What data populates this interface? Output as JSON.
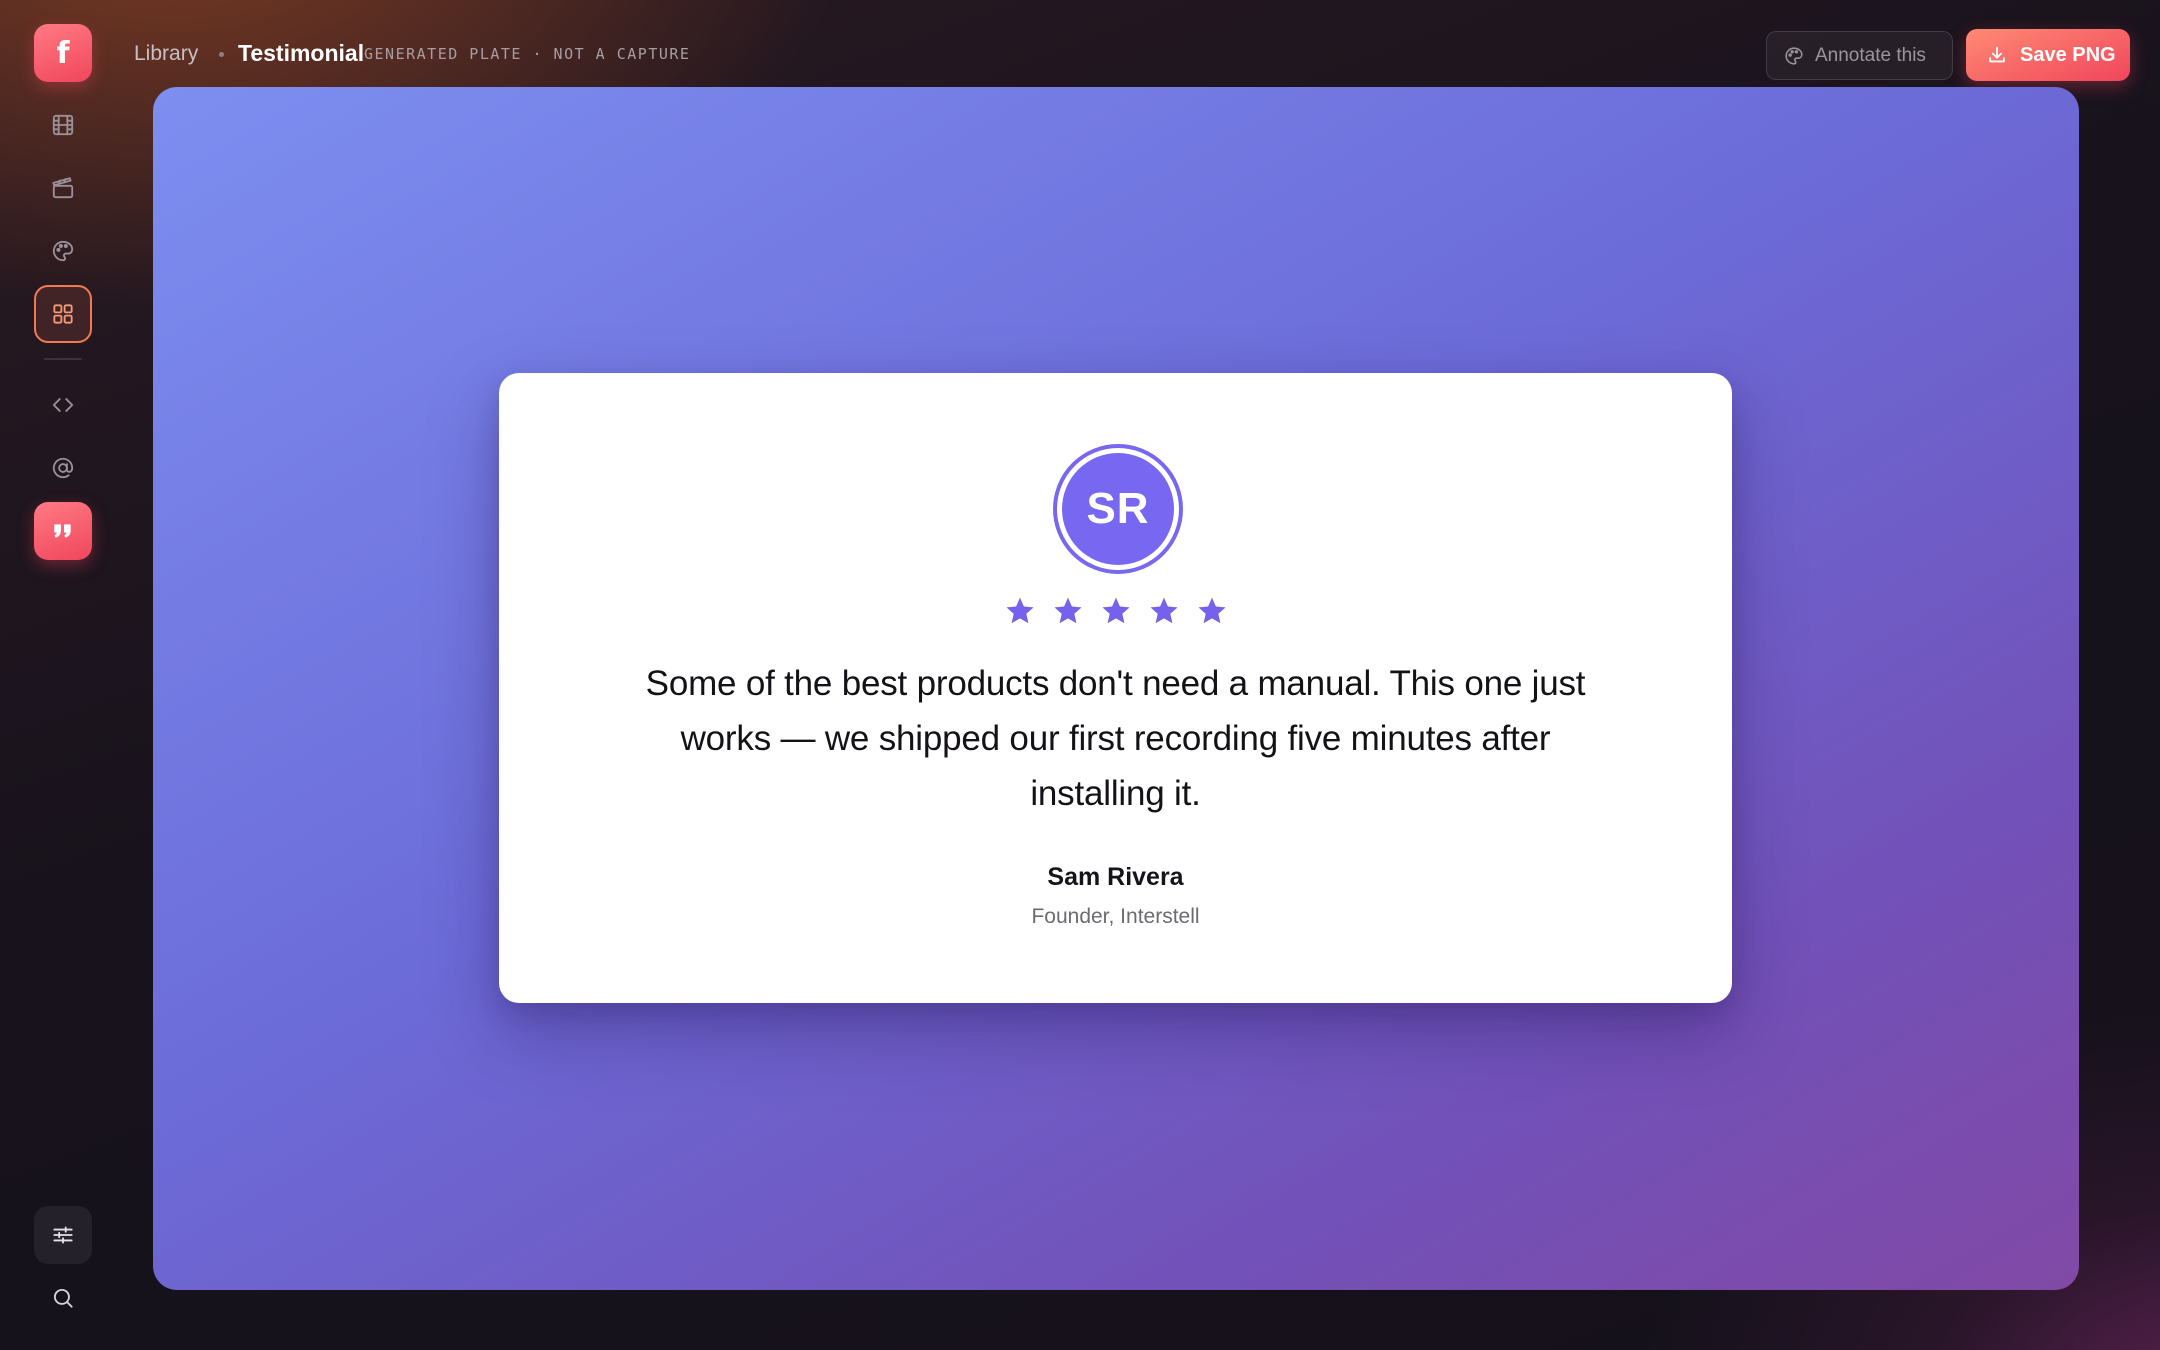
{
  "sidebar": {
    "logo_letter": "f",
    "items": [
      {
        "icon": "film-icon"
      },
      {
        "icon": "clapperboard-icon"
      },
      {
        "icon": "palette-icon"
      },
      {
        "icon": "grid-icon",
        "state": "selected"
      },
      {
        "icon": "code-icon"
      },
      {
        "icon": "at-sign-icon"
      },
      {
        "icon": "quote-icon",
        "state": "active"
      }
    ],
    "bottom_items": [
      {
        "icon": "sliders-icon"
      },
      {
        "icon": "search-icon"
      }
    ]
  },
  "header": {
    "breadcrumb_root": "Library",
    "title": "Testimonial",
    "tag": "GENERATED PLATE · NOT A CAPTURE",
    "annotate_label": "Annotate this",
    "save_label": "Save PNG"
  },
  "testimonial": {
    "initials": "SR",
    "rating": 5,
    "rating_max": 5,
    "quote": "Some of the best products don't need a manual. This one just works — we shipped our first recording five minutes after installing it.",
    "author_name": "Sam Rivera",
    "author_role": "Founder, Interstell"
  },
  "colors": {
    "accent": "#F0465B",
    "avatar": "#7767F1",
    "star": "#7462EF",
    "plate_start": "#7D8EF0",
    "plate_end": "#8149A6"
  }
}
